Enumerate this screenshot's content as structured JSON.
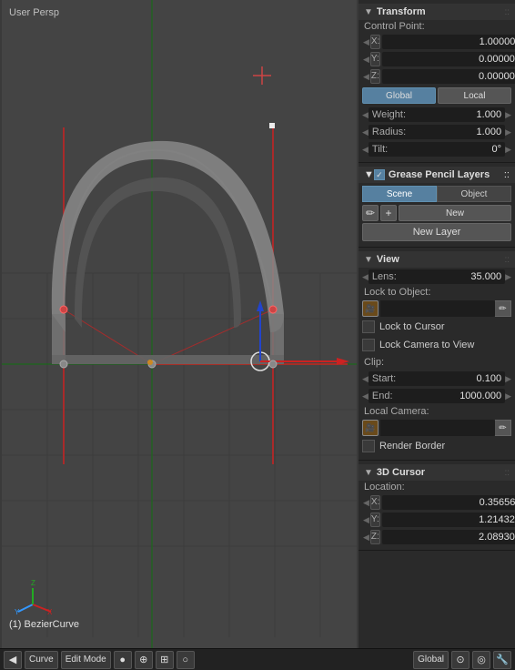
{
  "viewport": {
    "label": "User Persp",
    "object_label": "(1) BezierCurve"
  },
  "right_panel": {
    "transform": {
      "title": "Transform",
      "control_point_label": "Control Point:",
      "x_label": "X:",
      "x_value": "1.00000",
      "y_label": "Y:",
      "y_value": "0.00000",
      "z_label": "Z:",
      "z_value": "0.00000",
      "global_label": "Global",
      "local_label": "Local",
      "weight_label": "Weight:",
      "weight_value": "1.000",
      "radius_label": "Radius:",
      "radius_value": "1.000",
      "tilt_label": "Tilt:",
      "tilt_value": "0°"
    },
    "grease_pencil": {
      "title": "Grease Pencil Layers",
      "scene_label": "Scene",
      "object_label": "Object",
      "new_label": "New",
      "new_layer_label": "New Layer"
    },
    "view": {
      "title": "View",
      "lens_label": "Lens:",
      "lens_value": "35.000",
      "lock_to_object_label": "Lock to Object:",
      "lock_to_cursor_label": "Lock to Cursor",
      "lock_camera_label": "Lock Camera to View",
      "clip_label": "Clip:",
      "start_label": "Start:",
      "start_value": "0.100",
      "end_label": "End:",
      "end_value": "1000.000",
      "local_camera_label": "Local Camera:",
      "render_border_label": "Render Border"
    },
    "cursor3d": {
      "title": "3D Cursor",
      "location_label": "Location:",
      "x_label": "X:",
      "x_value": "0.35656",
      "y_label": "Y:",
      "y_value": "1.21432",
      "z_label": "Z:",
      "z_value": "2.08930"
    }
  },
  "bottom_toolbar": {
    "mode_icon": "◀",
    "curve_label": "Curve",
    "edit_mode_label": "Edit Mode",
    "global_label": "Global"
  }
}
